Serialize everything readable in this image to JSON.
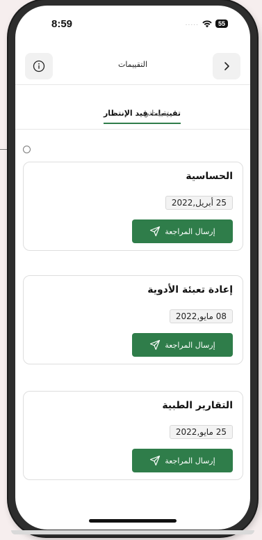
{
  "status": {
    "time": "8:59",
    "signal": ".....",
    "battery": "55"
  },
  "header": {
    "title": "التقييمات",
    "info_icon": "info-icon",
    "back_icon": "chevron-right-icon"
  },
  "tabs": [
    {
      "label": "تقييمات قيد الإنتظار",
      "active": true
    },
    {
      "label": "تقييماتي",
      "active": false
    }
  ],
  "cards": [
    {
      "title": "الحساسية",
      "date": "25 أبريل,2022",
      "button": "إرسال المراجعة"
    },
    {
      "title": "إعادة تعبئة الأدوية",
      "date": "08 مايو,2022",
      "button": "إرسال المراجعة"
    },
    {
      "title": "التقارير الطبية",
      "date": "25 مايو,2022",
      "button": "إرسال المراجعة"
    }
  ],
  "colors": {
    "accent": "#2f7d4a",
    "background": "#f6eeee"
  }
}
